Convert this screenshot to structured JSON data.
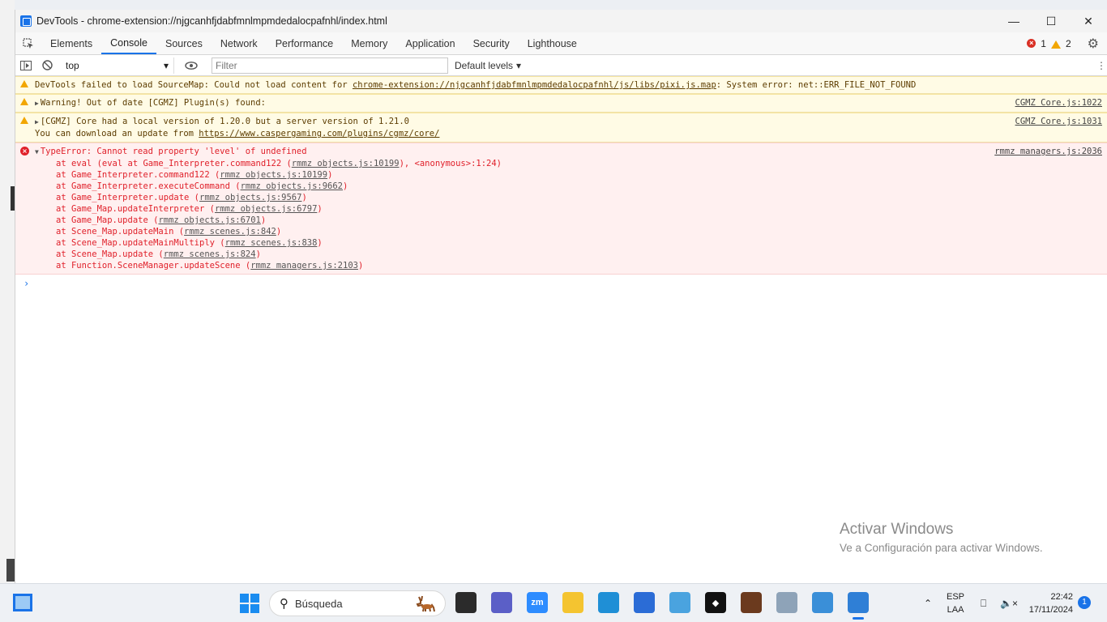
{
  "window": {
    "title": "DevTools - chrome-extension://njgcanhfjdabfmnlmpmdedalocpafnhl/index.html",
    "minimize_icon": "minimize-icon",
    "maximize_icon": "maximize-icon",
    "close_icon": "close-icon"
  },
  "tabs": [
    {
      "label": "Elements"
    },
    {
      "label": "Console",
      "active": true
    },
    {
      "label": "Sources"
    },
    {
      "label": "Network"
    },
    {
      "label": "Performance"
    },
    {
      "label": "Memory"
    },
    {
      "label": "Application"
    },
    {
      "label": "Security"
    },
    {
      "label": "Lighthouse"
    }
  ],
  "counts": {
    "errors": "1",
    "warnings": "2"
  },
  "console_toolbar": {
    "context": "top",
    "filter_placeholder": "Filter",
    "levels": "Default levels"
  },
  "messages": [
    {
      "type": "warning",
      "text_before": "DevTools failed to load SourceMap: Could not load content for ",
      "link": "chrome-extension://njgcanhfjdabfmnlmpmdedalocpafnhl/js/libs/pixi.js.map",
      "text_after": ": System error: net::ERR_FILE_NOT_FOUND"
    },
    {
      "type": "warning",
      "text": "Warning! Out of date [CGMZ] Plugin(s) found:",
      "source": "CGMZ Core.js:1022"
    },
    {
      "type": "warning",
      "text": "[CGMZ] Core had a local version of 1.20.0 but a server version of 1.21.0",
      "line2_before": "You can download an update from ",
      "line2_link": "https://www.caspergaming.com/plugins/cgmz/core/",
      "source": "CGMZ Core.js:1031"
    },
    {
      "type": "error",
      "text": "TypeError: Cannot read property 'level' of undefined",
      "source": "rmmz managers.js:2036"
    }
  ],
  "stack": [
    {
      "before": "at eval (eval at Game_Interpreter.command122 (",
      "link": "rmmz objects.js:10199",
      "after": "), <anonymous>:1:24)"
    },
    {
      "before": "at Game_Interpreter.command122 (",
      "link": "rmmz objects.js:10199",
      "after": ")"
    },
    {
      "before": "at Game_Interpreter.executeCommand (",
      "link": "rmmz objects.js:9662",
      "after": ")"
    },
    {
      "before": "at Game_Interpreter.update (",
      "link": "rmmz objects.js:9567",
      "after": ")"
    },
    {
      "before": "at Game_Map.updateInterpreter (",
      "link": "rmmz objects.js:6797",
      "after": ")"
    },
    {
      "before": "at Game_Map.update (",
      "link": "rmmz objects.js:6701",
      "after": ")"
    },
    {
      "before": "at Scene_Map.updateMain (",
      "link": "rmmz scenes.js:842",
      "after": ")"
    },
    {
      "before": "at Scene_Map.updateMainMultiply (",
      "link": "rmmz scenes.js:838",
      "after": ")"
    },
    {
      "before": "at Scene_Map.update (",
      "link": "rmmz scenes.js:824",
      "after": ")"
    },
    {
      "before": "at Function.SceneManager.updateScene (",
      "link": "rmmz managers.js:2103",
      "after": ")"
    }
  ],
  "prompt_symbol": "›",
  "watermark": {
    "title": "Activar Windows",
    "subtitle": "Ve a Configuración para activar Windows."
  },
  "taskbar": {
    "search_label": "Búsqueda",
    "apps": [
      {
        "name": "task-view-icon",
        "color": "#2b2b2b",
        "glyph": ""
      },
      {
        "name": "chat-icon",
        "color": "#5b5fc7",
        "glyph": ""
      },
      {
        "name": "zoom-icon",
        "color": "#2d8cff",
        "glyph": "zm"
      },
      {
        "name": "file-explorer-icon",
        "color": "#f4c430",
        "glyph": ""
      },
      {
        "name": "edge-icon",
        "color": "#1f8fd6",
        "glyph": ""
      },
      {
        "name": "store-icon",
        "color": "#2b6cd6",
        "glyph": ""
      },
      {
        "name": "control-panel-icon",
        "color": "#4aa3df",
        "glyph": ""
      },
      {
        "name": "app-black-icon",
        "color": "#111111",
        "glyph": "◆"
      },
      {
        "name": "game-icon",
        "color": "#6b3a1e",
        "glyph": ""
      },
      {
        "name": "castle-icon",
        "color": "#8ea3b8",
        "glyph": ""
      },
      {
        "name": "rpgmaker-icon",
        "color": "#3a8fd8",
        "glyph": ""
      },
      {
        "name": "devtools-taskbar-icon",
        "color": "#2f7fd6",
        "glyph": "",
        "active": true
      }
    ],
    "lang_top": "ESP",
    "lang_bottom": "LAA",
    "time": "22:42",
    "date": "17/11/2024",
    "notifications": "1"
  }
}
